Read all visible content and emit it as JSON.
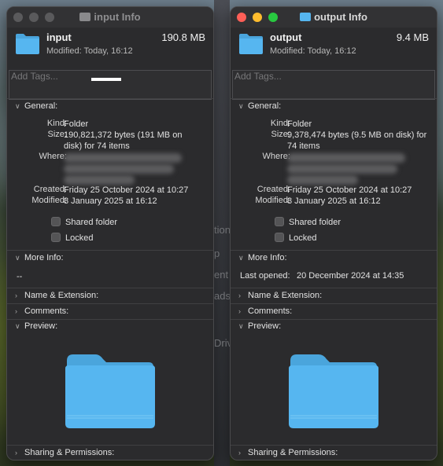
{
  "left_window": {
    "title": "input Info",
    "name": "input",
    "size": "190.8 MB",
    "modified_header": "Modified: Today, 16:12",
    "tags_placeholder": "Add Tags...",
    "general": {
      "heading": "General:",
      "kind_label": "Kind:",
      "kind_value": "Folder",
      "size_label": "Size:",
      "size_value": "190,821,372 bytes (191 MB on disk) for 74 items",
      "where_label": "Where:",
      "created_label": "Created:",
      "created_value": "Friday 25 October 2024 at 10:27",
      "modified_label": "Modified:",
      "modified_value": "8 January 2025 at 16:12",
      "shared_folder": "Shared folder",
      "locked": "Locked"
    },
    "more_info": {
      "heading": "More Info:",
      "value": "--"
    },
    "name_extension": "Name & Extension:",
    "comments": "Comments:",
    "preview": "Preview:",
    "sharing": "Sharing & Permissions:"
  },
  "right_window": {
    "title": "output Info",
    "name": "output",
    "size": "9.4 MB",
    "modified_header": "Modified: Today, 16:12",
    "tags_placeholder": "Add Tags...",
    "general": {
      "heading": "General:",
      "kind_label": "Kind:",
      "kind_value": "Folder",
      "size_label": "Size:",
      "size_value": "9,378,474 bytes (9.5 MB on disk) for 74 items",
      "where_label": "Where:",
      "created_label": "Created:",
      "created_value": "Friday 25 October 2024 at 10:27",
      "modified_label": "Modified:",
      "modified_value": "8 January 2025 at 16:12",
      "shared_folder": "Shared folder",
      "locked": "Locked"
    },
    "more_info": {
      "heading": "More Info:",
      "last_opened_label": "Last opened:",
      "last_opened_value": "20 December 2024 at 14:35"
    },
    "name_extension": "Name & Extension:",
    "comments": "Comments:",
    "preview": "Preview:",
    "sharing": "Sharing & Permissions:"
  },
  "background_fragments": [
    "tion",
    "p",
    "ent",
    "ads",
    "Driv"
  ],
  "colors": {
    "folder_blue": "#56b6f0",
    "close_red": "#fe5f57",
    "minimize_yellow": "#febc2e",
    "zoom_green": "#28c840"
  }
}
